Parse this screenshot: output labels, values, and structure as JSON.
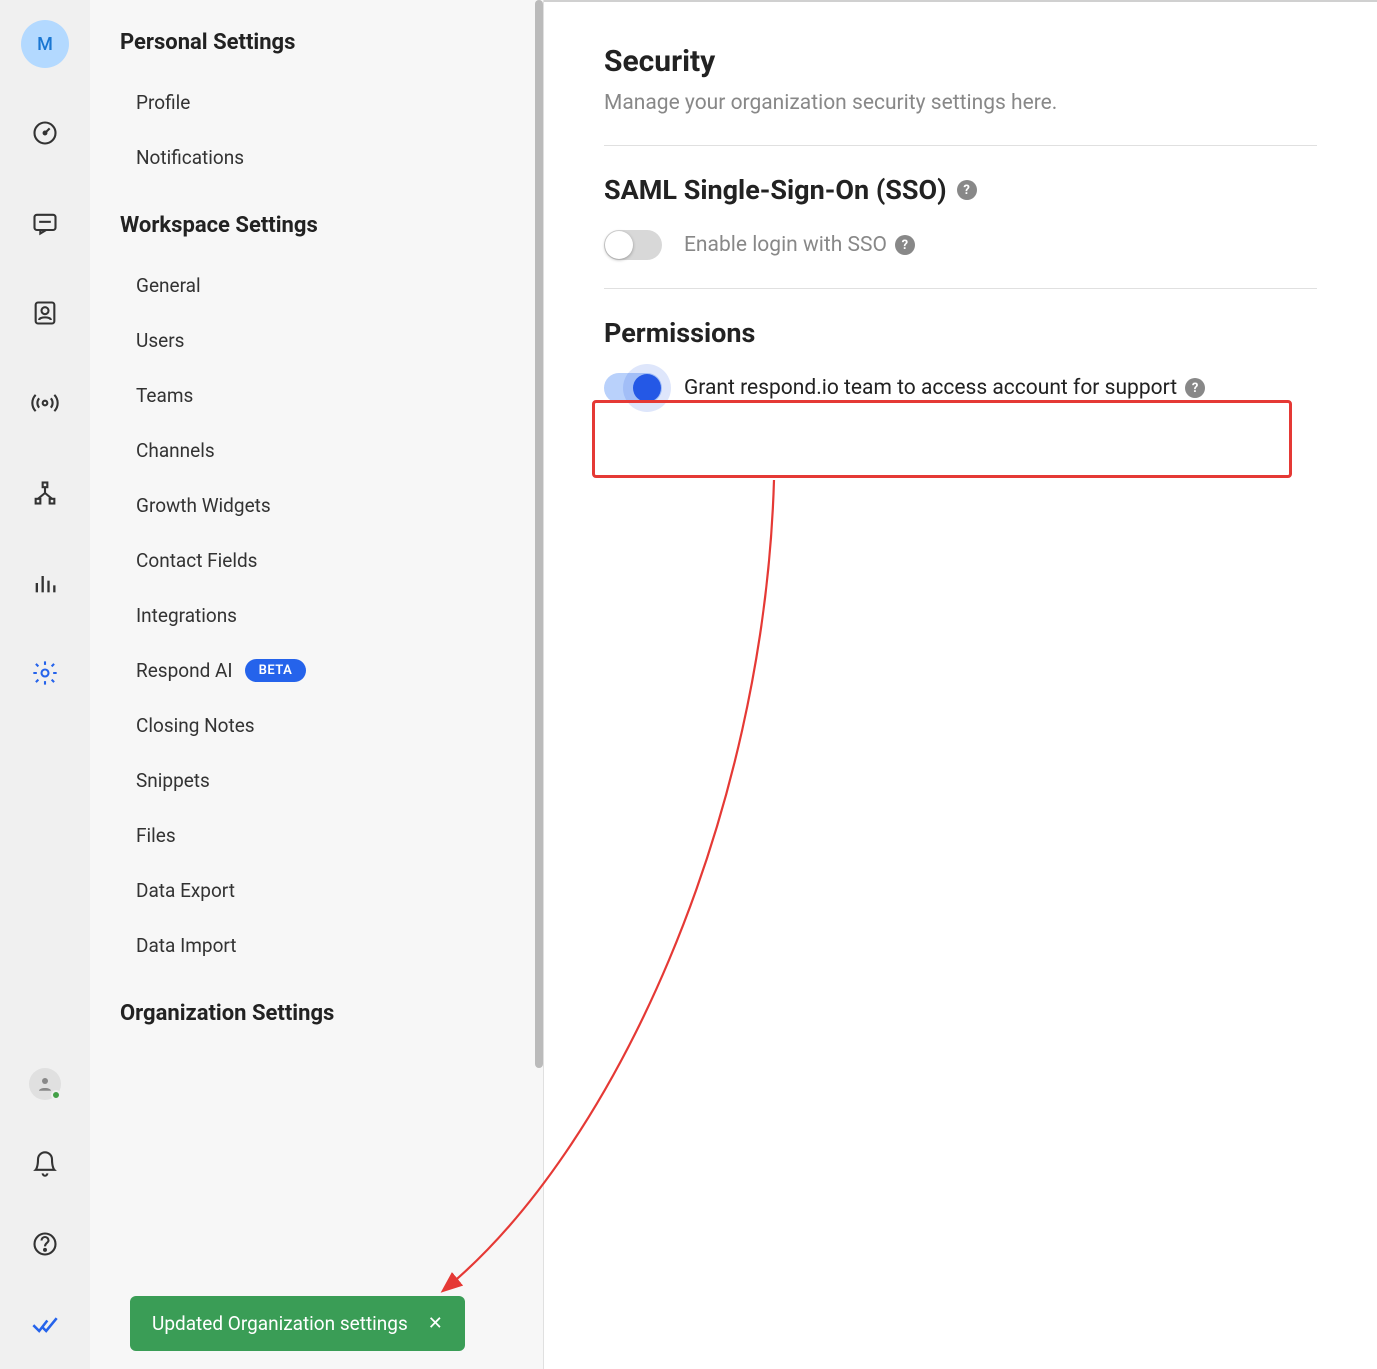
{
  "avatar_letter": "M",
  "sidebar": {
    "groups": [
      {
        "title": "Personal Settings",
        "items": [
          {
            "label": "Profile"
          },
          {
            "label": "Notifications"
          }
        ]
      },
      {
        "title": "Workspace Settings",
        "items": [
          {
            "label": "General"
          },
          {
            "label": "Users"
          },
          {
            "label": "Teams"
          },
          {
            "label": "Channels"
          },
          {
            "label": "Growth Widgets"
          },
          {
            "label": "Contact Fields"
          },
          {
            "label": "Integrations"
          },
          {
            "label": "Respond AI",
            "badge": "BETA"
          },
          {
            "label": "Closing Notes"
          },
          {
            "label": "Snippets"
          },
          {
            "label": "Files"
          },
          {
            "label": "Data Export"
          },
          {
            "label": "Data Import"
          }
        ]
      },
      {
        "title": "Organization Settings",
        "items": []
      }
    ]
  },
  "toast": {
    "message": "Updated Organization settings",
    "close_glyph": "✕"
  },
  "main": {
    "title": "Security",
    "subtitle": "Manage your organization security settings here.",
    "sections": [
      {
        "title": "SAML Single-Sign-On (SSO)",
        "help": "?",
        "toggle_on": false,
        "toggle_label": "Enable login with SSO",
        "toggle_help": "?"
      },
      {
        "title": "Permissions",
        "toggle_on": true,
        "toggle_label": "Grant respond.io team to access account for support",
        "toggle_help": "?"
      }
    ]
  },
  "help_glyph": "?"
}
